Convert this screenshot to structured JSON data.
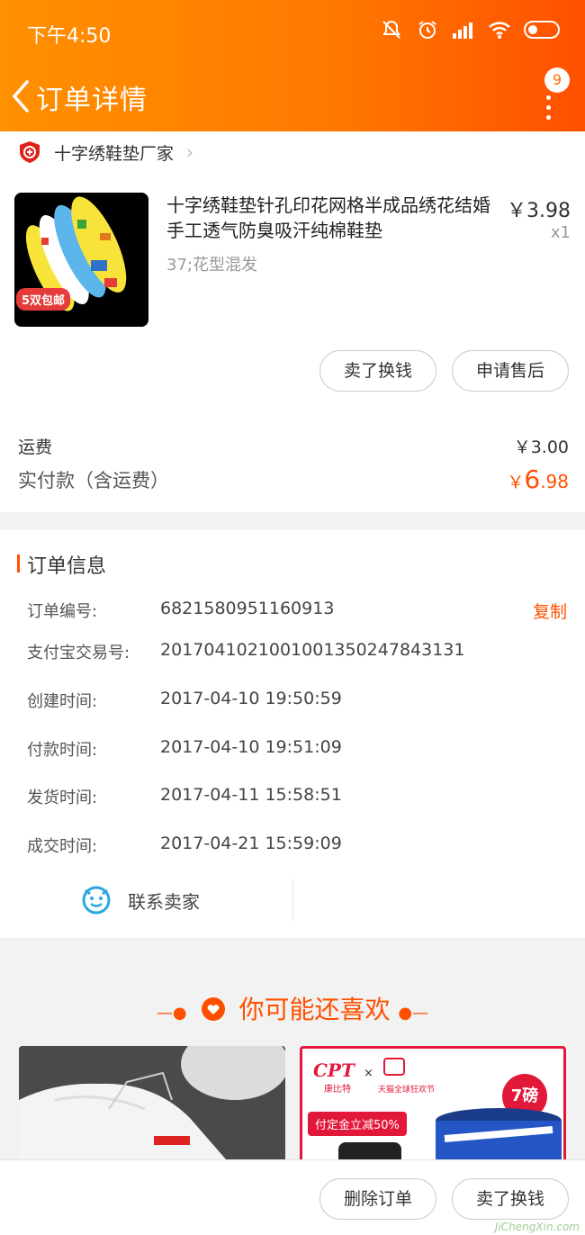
{
  "status_bar": {
    "time": "下午4:50"
  },
  "nav": {
    "title": "订单详情",
    "badge": "9"
  },
  "shop": {
    "name": "十字绣鞋垫厂家"
  },
  "product": {
    "title": "十字绣鞋垫针孔印花网格半成品绣花结婚手工透气防臭吸汗纯棉鞋垫",
    "sku": "37;花型混发",
    "price": "￥3.98",
    "quantity": "x1",
    "image_badge": "5双包邮",
    "buttons": {
      "sell": "卖了换钱",
      "after_sale": "申请售后"
    }
  },
  "summary": {
    "shipping_label": "运费",
    "shipping_value": "￥3.00",
    "paid_label": "实付款（含运费）",
    "paid_currency": "￥",
    "paid_int": "6",
    "paid_dec": ".98"
  },
  "order_info": {
    "title": "订单信息",
    "copy_label": "复制",
    "rows": [
      {
        "label": "订单编号:",
        "value": "6821580951160913"
      },
      {
        "label": "支付宝交易号:",
        "value": "2017041021001001350247843131"
      },
      {
        "label": "创建时间:",
        "value": "2017-04-10 19:50:59"
      },
      {
        "label": "付款时间:",
        "value": "2017-04-10 19:51:09"
      },
      {
        "label": "发货时间:",
        "value": "2017-04-11 15:58:51"
      },
      {
        "label": "成交时间:",
        "value": "2017-04-21 15:59:09"
      }
    ],
    "contact_label": "联系卖家"
  },
  "recommend": {
    "title": "你可能还喜欢",
    "ad_texts": {
      "brand": "CPT",
      "brand_sub": "康比特",
      "event": "天猫全球狂欢节",
      "discount": "付定金立减50%",
      "weight": "7磅"
    }
  },
  "footer": {
    "delete_label": "删除订单",
    "sell_label": "卖了换钱"
  },
  "watermark": "JiChengXin.com",
  "colors": {
    "accent": "#ff5000",
    "header_start": "#ff9000",
    "header_end": "#ff5000"
  }
}
